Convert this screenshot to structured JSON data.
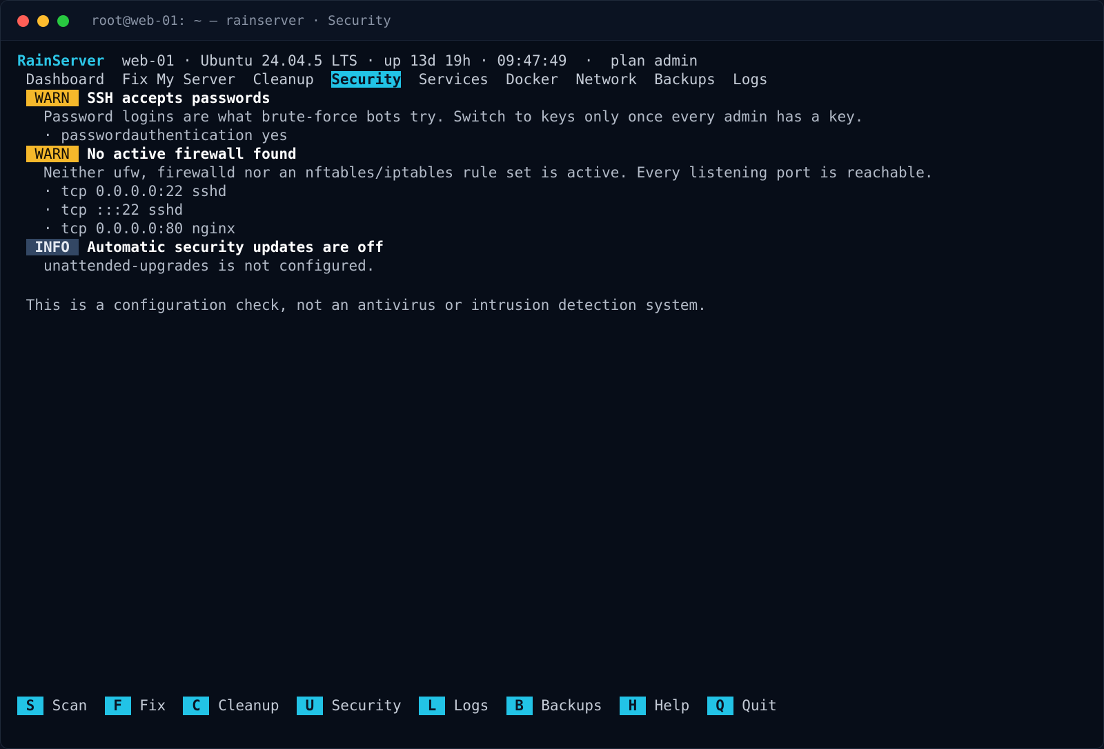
{
  "window": {
    "title": "root@web-01: ~ — rainserver · Security",
    "controls": [
      "close",
      "minimize",
      "maximize"
    ]
  },
  "header": {
    "brand": "RainServer",
    "status": "web-01 · Ubuntu 24.04.5 LTS · up 13d 19h · 09:47:49  ·  plan admin"
  },
  "tabs": [
    {
      "label": "Dashboard",
      "active": false
    },
    {
      "label": "Fix My Server",
      "active": false
    },
    {
      "label": "Cleanup",
      "active": false
    },
    {
      "label": "Security",
      "active": true
    },
    {
      "label": "Services",
      "active": false
    },
    {
      "label": "Docker",
      "active": false
    },
    {
      "label": "Network",
      "active": false
    },
    {
      "label": "Backups",
      "active": false
    },
    {
      "label": "Logs",
      "active": false
    }
  ],
  "findings": [
    {
      "level": "WARN",
      "title": "SSH accepts passwords",
      "description": "Password logins are what brute-force bots try. Switch to keys only once every admin has a key.",
      "details": [
        "· passwordauthentication yes"
      ]
    },
    {
      "level": "WARN",
      "title": "No active firewall found",
      "description": "Neither ufw, firewalld nor an nftables/iptables rule set is active. Every listening port is reachable.",
      "details": [
        "· tcp 0.0.0.0:22 sshd",
        "· tcp :::22 sshd",
        "· tcp 0.0.0.0:80 nginx"
      ]
    },
    {
      "level": "INFO",
      "title": "Automatic security updates are off",
      "description": "unattended-upgrades is not configured.",
      "details": []
    }
  ],
  "disclaimer": "This is a configuration check, not an antivirus or intrusion detection system.",
  "footer": {
    "shortcuts": [
      {
        "key": "S",
        "label": "Scan"
      },
      {
        "key": "F",
        "label": "Fix"
      },
      {
        "key": "C",
        "label": "Cleanup"
      },
      {
        "key": "U",
        "label": "Security"
      },
      {
        "key": "L",
        "label": "Logs"
      },
      {
        "key": "B",
        "label": "Backups"
      },
      {
        "key": "H",
        "label": "Help"
      },
      {
        "key": "Q",
        "label": "Quit"
      }
    ]
  },
  "colors": {
    "accent": "#22c3e6",
    "warn": "#f5b82b",
    "info": "#334764",
    "background": "#070d18"
  }
}
